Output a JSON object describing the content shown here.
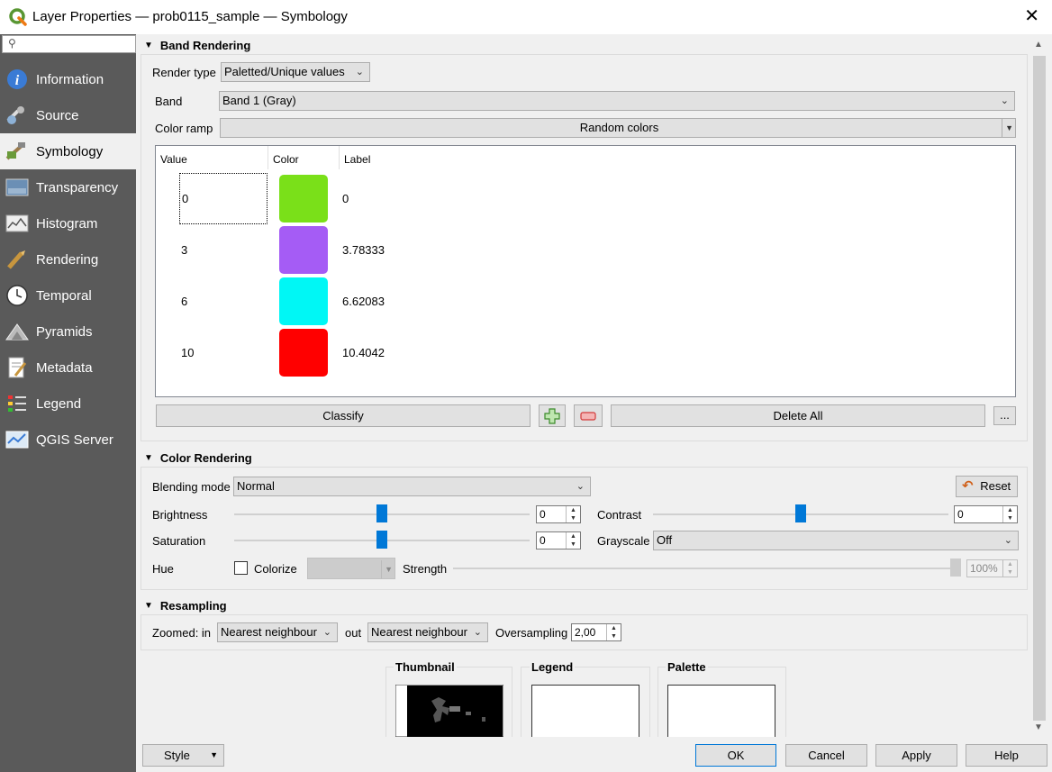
{
  "window": {
    "title": "Layer Properties — prob0115_sample — Symbology",
    "close_glyph": "✕"
  },
  "search": {
    "placeholder": ""
  },
  "sidebar": {
    "items": [
      {
        "label": "Information",
        "icon": "info-icon"
      },
      {
        "label": "Source",
        "icon": "source-icon"
      },
      {
        "label": "Symbology",
        "icon": "symbology-icon"
      },
      {
        "label": "Transparency",
        "icon": "transparency-icon"
      },
      {
        "label": "Histogram",
        "icon": "histogram-icon"
      },
      {
        "label": "Rendering",
        "icon": "rendering-icon"
      },
      {
        "label": "Temporal",
        "icon": "clock-icon"
      },
      {
        "label": "Pyramids",
        "icon": "pyramids-icon"
      },
      {
        "label": "Metadata",
        "icon": "metadata-icon"
      },
      {
        "label": "Legend",
        "icon": "legend-icon"
      },
      {
        "label": "QGIS Server",
        "icon": "server-icon"
      }
    ],
    "active_index": 2
  },
  "band_rendering": {
    "header": "Band Rendering",
    "render_type_label": "Render type",
    "render_type_value": "Paletted/Unique values",
    "band_label": "Band",
    "band_value": "Band 1 (Gray)",
    "color_ramp_label": "Color ramp",
    "color_ramp_value": "Random colors",
    "table": {
      "headers": [
        "Value",
        "Color",
        "Label"
      ],
      "rows": [
        {
          "value": "0",
          "color": "#7ae019",
          "label": "0"
        },
        {
          "value": "3",
          "color": "#a55cf5",
          "label": "3.78333"
        },
        {
          "value": "6",
          "color": "#00f7f5",
          "label": "6.62083"
        },
        {
          "value": "10",
          "color": "#ff0000",
          "label": "10.4042"
        }
      ]
    },
    "classify_label": "Classify",
    "delete_all_label": "Delete All",
    "more_label": "..."
  },
  "color_rendering": {
    "header": "Color Rendering",
    "blending_mode_label": "Blending mode",
    "blending_mode_value": "Normal",
    "reset_label": "Reset",
    "brightness_label": "Brightness",
    "brightness_value": "0",
    "contrast_label": "Contrast",
    "contrast_value": "0",
    "saturation_label": "Saturation",
    "saturation_value": "0",
    "grayscale_label": "Grayscale",
    "grayscale_value": "Off",
    "hue_label": "Hue",
    "colorize_label": "Colorize",
    "strength_label": "Strength",
    "strength_value": "100%"
  },
  "resampling": {
    "header": "Resampling",
    "zoomed_in_label": "Zoomed: in",
    "zoomed_in_value": "Nearest neighbour",
    "out_label": "out",
    "out_value": "Nearest neighbour",
    "oversampling_label": "Oversampling",
    "oversampling_value": "2,00"
  },
  "previews": {
    "thumbnail_label": "Thumbnail",
    "legend_label": "Legend",
    "palette_label": "Palette"
  },
  "footer": {
    "style_label": "Style",
    "ok_label": "OK",
    "cancel_label": "Cancel",
    "apply_label": "Apply",
    "help_label": "Help"
  }
}
